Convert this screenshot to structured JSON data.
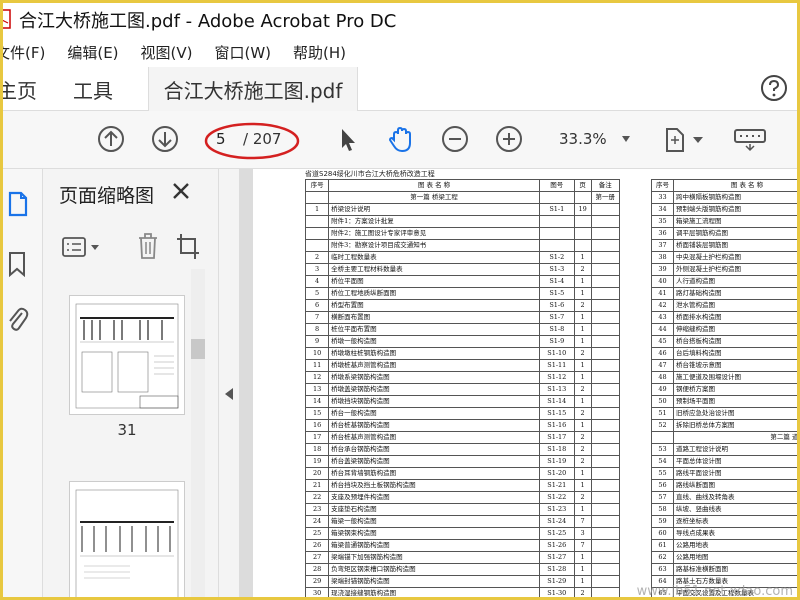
{
  "window": {
    "title": "合江大桥施工图.pdf - Adobe Acrobat Pro DC"
  },
  "menu": [
    "文件(F)",
    "编辑(E)",
    "视图(V)",
    "窗口(W)",
    "帮助(H)"
  ],
  "tabs": {
    "home": "主页",
    "tools": "工具",
    "document": "合江大桥施工图.pdf"
  },
  "toolbar": {
    "page_current": "5",
    "page_total": "/ 207",
    "zoom": "33.3%"
  },
  "panel": {
    "title": "页面缩略图",
    "thumb_label": "31"
  },
  "doc": {
    "heading": "省道S284绥化川市合江大桥危桥改造工程",
    "header": {
      "no": "序号",
      "name": "图  表  名  称",
      "code": "图号",
      "page": "页",
      "note": "备注"
    },
    "part1": {
      "title": "第一篇  桥梁工程",
      "note": "第一册"
    },
    "rows": [
      {
        "no": "1",
        "name": "桥梁设计说明",
        "code": "S1-1",
        "page": "19",
        "note": ""
      },
      {
        "no": "",
        "name": "附件1：方案设计批复",
        "code": "",
        "page": "",
        "note": ""
      },
      {
        "no": "",
        "name": "附件2：施工图设计专家评审意见",
        "code": "",
        "page": "",
        "note": ""
      },
      {
        "no": "",
        "name": "附件3：勘察设计项目成交通知书",
        "code": "",
        "page": "",
        "note": ""
      },
      {
        "no": "2",
        "name": "临时工程数量表",
        "code": "S1-2",
        "page": "1",
        "note": ""
      },
      {
        "no": "3",
        "name": "全桥主要工程材料数量表",
        "code": "S1-3",
        "page": "2",
        "note": ""
      },
      {
        "no": "4",
        "name": "桥位平面图",
        "code": "S1-4",
        "page": "1",
        "note": ""
      },
      {
        "no": "5",
        "name": "桥位工程地质纵断面图",
        "code": "S1-5",
        "page": "1",
        "note": ""
      },
      {
        "no": "6",
        "name": "桥型布置图",
        "code": "S1-6",
        "page": "2",
        "note": ""
      },
      {
        "no": "7",
        "name": "横断面布置图",
        "code": "S1-7",
        "page": "1",
        "note": ""
      },
      {
        "no": "8",
        "name": "桩位平面布置图",
        "code": "S1-8",
        "page": "1",
        "note": ""
      },
      {
        "no": "9",
        "name": "桥墩一般构造图",
        "code": "S1-9",
        "page": "1",
        "note": ""
      },
      {
        "no": "10",
        "name": "桥墩墩柱桩钢筋构造图",
        "code": "S1-10",
        "page": "2",
        "note": ""
      },
      {
        "no": "11",
        "name": "桥墩桩基声测管构造图",
        "code": "S1-11",
        "page": "1",
        "note": ""
      },
      {
        "no": "12",
        "name": "桥墩系梁钢筋构造图",
        "code": "S1-12",
        "page": "1",
        "note": ""
      },
      {
        "no": "13",
        "name": "桥墩盖梁钢筋构造图",
        "code": "S1-13",
        "page": "2",
        "note": ""
      },
      {
        "no": "14",
        "name": "桥墩挡块钢筋构造图",
        "code": "S1-14",
        "page": "1",
        "note": ""
      },
      {
        "no": "15",
        "name": "桥台一般构造图",
        "code": "S1-15",
        "page": "2",
        "note": ""
      },
      {
        "no": "16",
        "name": "桥台桩基钢筋构造图",
        "code": "S1-16",
        "page": "1",
        "note": ""
      },
      {
        "no": "17",
        "name": "桥台桩基声测管构造图",
        "code": "S1-17",
        "page": "2",
        "note": ""
      },
      {
        "no": "18",
        "name": "桥台承台钢筋构造图",
        "code": "S1-18",
        "page": "2",
        "note": ""
      },
      {
        "no": "19",
        "name": "桥台盖梁钢筋构造图",
        "code": "S1-19",
        "page": "2",
        "note": ""
      },
      {
        "no": "20",
        "name": "桥台耳背墙钢筋构造图",
        "code": "S1-20",
        "page": "1",
        "note": ""
      },
      {
        "no": "21",
        "name": "桥台挡块及挡土板钢筋构造图",
        "code": "S1-21",
        "page": "1",
        "note": ""
      },
      {
        "no": "22",
        "name": "支座及预埋件构造图",
        "code": "S1-22",
        "page": "2",
        "note": ""
      },
      {
        "no": "23",
        "name": "支座垫石构造图",
        "code": "S1-23",
        "page": "1",
        "note": ""
      },
      {
        "no": "24",
        "name": "箱梁一般构造图",
        "code": "S1-24",
        "page": "7",
        "note": ""
      },
      {
        "no": "25",
        "name": "箱梁钢束构造图",
        "code": "S1-25",
        "page": "3",
        "note": ""
      },
      {
        "no": "26",
        "name": "箱梁普通钢筋构造图",
        "code": "S1-26",
        "page": "7",
        "note": ""
      },
      {
        "no": "27",
        "name": "梁端锚下加强钢筋构造图",
        "code": "S1-27",
        "page": "1",
        "note": ""
      },
      {
        "no": "28",
        "name": "负弯矩区钢束槽口钢筋构造图",
        "code": "S1-28",
        "page": "1",
        "note": ""
      },
      {
        "no": "29",
        "name": "梁端封锚钢筋构造图",
        "code": "S1-29",
        "page": "1",
        "note": ""
      },
      {
        "no": "30",
        "name": "现浇湿接缝钢筋构造图",
        "code": "S1-30",
        "page": "2",
        "note": ""
      }
    ],
    "right_header": {
      "no": "序号",
      "name": "图  表  名  称"
    },
    "right_rows": [
      {
        "no": "33",
        "name": "跨中横隔板钢筋构造图"
      },
      {
        "no": "34",
        "name": "预制端头版钢筋构造图"
      },
      {
        "no": "35",
        "name": "箱梁施工流程图"
      },
      {
        "no": "36",
        "name": "调平层钢筋构造图"
      },
      {
        "no": "37",
        "name": "桥面铺装层钢筋图"
      },
      {
        "no": "38",
        "name": "中央混凝土护栏构造图"
      },
      {
        "no": "39",
        "name": "外侧混凝土护栏构造图"
      },
      {
        "no": "40",
        "name": "人行道构造图"
      },
      {
        "no": "41",
        "name": "路灯基础构造图"
      },
      {
        "no": "42",
        "name": "泄水管构造图"
      },
      {
        "no": "43",
        "name": "桥面排水构造图"
      },
      {
        "no": "44",
        "name": "伸缩缝构造图"
      },
      {
        "no": "45",
        "name": "桥台搭板构造图"
      },
      {
        "no": "46",
        "name": "台后填料构造图"
      },
      {
        "no": "47",
        "name": "桥台锥坡示意图"
      },
      {
        "no": "48",
        "name": "施工便道及围堰设计图"
      },
      {
        "no": "49",
        "name": "钢便桥方案图"
      },
      {
        "no": "50",
        "name": "预制场平面图"
      },
      {
        "no": "51",
        "name": "旧桥应急处治设计图"
      },
      {
        "no": "52",
        "name": "拆除旧桥总体方案图"
      },
      {
        "no": "",
        "name": "第二篇  道路工程"
      },
      {
        "no": "53",
        "name": "道路工程设计说明"
      },
      {
        "no": "54",
        "name": "平面总体设计图"
      },
      {
        "no": "55",
        "name": "路线平面设计图"
      },
      {
        "no": "56",
        "name": "路线纵断面图"
      },
      {
        "no": "57",
        "name": "直线、曲线及转角表"
      },
      {
        "no": "58",
        "name": "纵坡、竖曲线表"
      },
      {
        "no": "59",
        "name": "逐桩坐标表"
      },
      {
        "no": "60",
        "name": "导线点成果表"
      },
      {
        "no": "61",
        "name": "公路用地表"
      },
      {
        "no": "62",
        "name": "公路用地图"
      },
      {
        "no": "63",
        "name": "路基标准横断面图"
      },
      {
        "no": "64",
        "name": "路基土石方数量表"
      },
      {
        "no": "65",
        "name": "平面交叉设置及工程数量表"
      }
    ]
  },
  "watermark": "www.jb51.net  xdao.com",
  "colors": {
    "border": "#e8c840",
    "oval": "#d42020",
    "accent_blue": "#1a73e8"
  },
  "icons": [
    "pdf-file-icon",
    "help-icon",
    "up-arrow-icon",
    "down-arrow-icon",
    "select-cursor-icon",
    "hand-tool-icon",
    "zoom-out-icon",
    "zoom-in-icon",
    "page-fit-icon",
    "keyboard-icon",
    "pages-icon",
    "bookmark-icon",
    "attachment-icon",
    "close-icon",
    "thumbnail-options-icon",
    "delete-icon",
    "crop-icon",
    "collapse-left-icon"
  ]
}
